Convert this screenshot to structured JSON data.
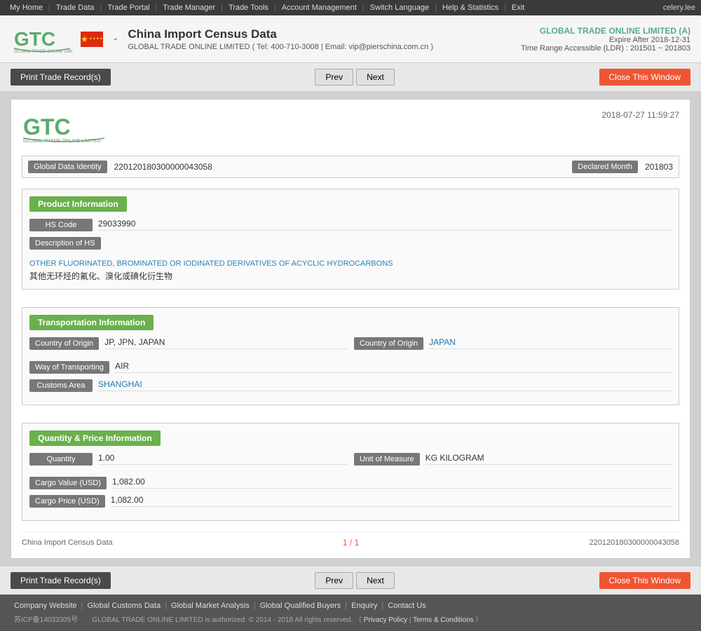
{
  "nav": {
    "items": [
      {
        "label": "My Home",
        "has_arrow": true
      },
      {
        "label": "Trade Data",
        "has_arrow": true
      },
      {
        "label": "Trade Portal",
        "has_arrow": true
      },
      {
        "label": "Trade Manager",
        "has_arrow": true
      },
      {
        "label": "Trade Tools",
        "has_arrow": true
      },
      {
        "label": "Account Management",
        "has_arrow": true
      },
      {
        "label": "Switch Language",
        "has_arrow": true
      },
      {
        "label": "Help & Statistics",
        "has_arrow": true
      },
      {
        "label": "Exit",
        "has_arrow": false
      }
    ],
    "user": "celery.lee"
  },
  "header": {
    "title": "China Import Census Data",
    "dash": "-",
    "subtitle": "GLOBAL TRADE ONLINE LIMITED ( Tel: 400-710-3008 | Email: vip@pierschina.com.cn )",
    "company": "GLOBAL TRADE ONLINE LIMITED (A)",
    "expire": "Expire After 2018-12-31",
    "range": "Time Range Accessible (LDR) : 201501 ~ 201803"
  },
  "toolbar": {
    "print_label": "Print Trade Record(s)",
    "prev_label": "Prev",
    "next_label": "Next",
    "close_label": "Close This Window"
  },
  "record": {
    "logo_text": "GTC",
    "logo_sub": "GLOBAL TRADE ONLINE LIMITED",
    "timestamp": "2018-07-27 11:59:27",
    "global_data_identity_label": "Global Data Identity",
    "global_data_identity_value": "220120180300000043058",
    "declared_month_label": "Declared Month",
    "declared_month_value": "201803",
    "sections": {
      "product": {
        "title": "Product Information",
        "hs_code_label": "HS Code",
        "hs_code_value": "29033990",
        "desc_of_hs_label": "Description of HS",
        "desc_en": "OTHER FLUORINATED, BROMINATED OR IODINATED DERIVATIVES OF ACYCLIC HYDROCARBONS",
        "desc_cn": "其他无环烃的氟化、溴化或碘化衍生物"
      },
      "transport": {
        "title": "Transportation Information",
        "country_of_origin_label": "Country of Origin",
        "country_of_origin_value": "JP, JPN, JAPAN",
        "country_of_origin2_label": "Country of Origin",
        "country_of_origin2_value": "JAPAN",
        "way_of_transporting_label": "Way of Transporting",
        "way_of_transporting_value": "AIR",
        "customs_area_label": "Customs Area",
        "customs_area_value": "SHANGHAI"
      },
      "quantity": {
        "title": "Quantity & Price Information",
        "quantity_label": "Quantity",
        "quantity_value": "1.00",
        "unit_of_measure_label": "Unit of Measure",
        "unit_of_measure_value": "KG KILOGRAM",
        "cargo_value_label": "Cargo Value (USD)",
        "cargo_value_value": "1,082.00",
        "cargo_price_label": "Cargo Price (USD)",
        "cargo_price_value": "1,082.00"
      }
    },
    "footer": {
      "source": "China Import Census Data",
      "page": "1 / 1",
      "id": "220120180300000043058"
    }
  },
  "page_footer": {
    "links": [
      {
        "label": "Company Website"
      },
      {
        "label": "Global Customs Data"
      },
      {
        "label": "Global Market Analysis"
      },
      {
        "label": "Global Qualified Buyers"
      },
      {
        "label": "Enquiry"
      },
      {
        "label": "Contact Us"
      }
    ],
    "copyright": "GLOBAL TRADE ONLINE LIMITED is authorized. © 2014 - 2018 All rights reserved.  （",
    "privacy": "Privacy Policy",
    "sep": "|",
    "conditions": "Terms & Conditions",
    "copyright_end": "）",
    "icp": "苏ICP备14033305号"
  }
}
